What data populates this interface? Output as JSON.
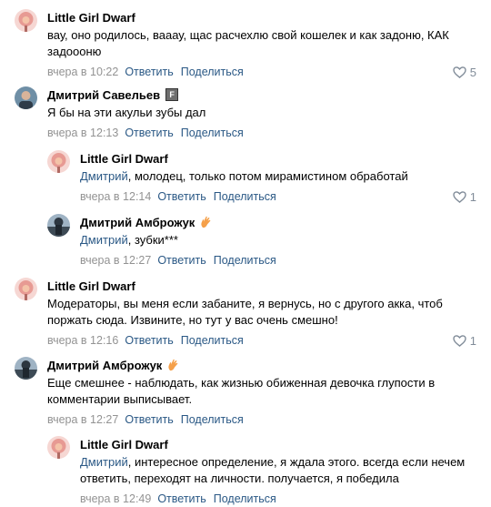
{
  "ui": {
    "reply_label": "Ответить",
    "share_label": "Поделиться"
  },
  "comments": [
    {
      "author": "Little Girl Dwarf",
      "text_lines": [
        "вау, оно родилось, вааау, щас расчехлю свой кошелек и как задоню, КАК",
        "задоооню"
      ],
      "time": "вчера в 10:22",
      "likes": "5"
    },
    {
      "author": "Дмитрий Савельев",
      "badge": "F",
      "text_lines": [
        "Я бы на эти акульи зубы дал"
      ],
      "time": "вчера в 12:13",
      "likes": ""
    },
    {
      "author": "Little Girl Dwarf",
      "mention": "Дмитрий",
      "text": ", молодец, только потом мирамистином обработай",
      "time": "вчера в 12:14",
      "likes": "1"
    },
    {
      "author": "Дмитрий Амброжук",
      "emoji": "hand-emoji",
      "mention": "Дмитрий",
      "text": ", зубки***",
      "time": "вчера в 12:27",
      "likes": ""
    },
    {
      "author": "Little Girl Dwarf",
      "text_lines": [
        "Модераторы, вы меня если забаните, я вернусь, но с другого акка, чтоб",
        "поржать сюда. Извините, но тут у вас очень смешно!"
      ],
      "time": "вчера в 12:16",
      "likes": "1"
    },
    {
      "author": "Дмитрий Амброжук",
      "emoji": "hand-emoji",
      "text_lines": [
        "Еще смешнее - наблюдать, как жизнью обиженная девочка глупости в",
        "комментарии выписывает."
      ],
      "time": "вчера в 12:27",
      "likes": ""
    },
    {
      "author": "Little Girl Dwarf",
      "mention": "Дмитрий",
      "text_lines": [
        ", интересное определение, я ждала этого. всегда если нечем",
        "ответить, переходят на личности. получается, я победила"
      ],
      "time": "вчера в 12:49",
      "likes": ""
    }
  ]
}
